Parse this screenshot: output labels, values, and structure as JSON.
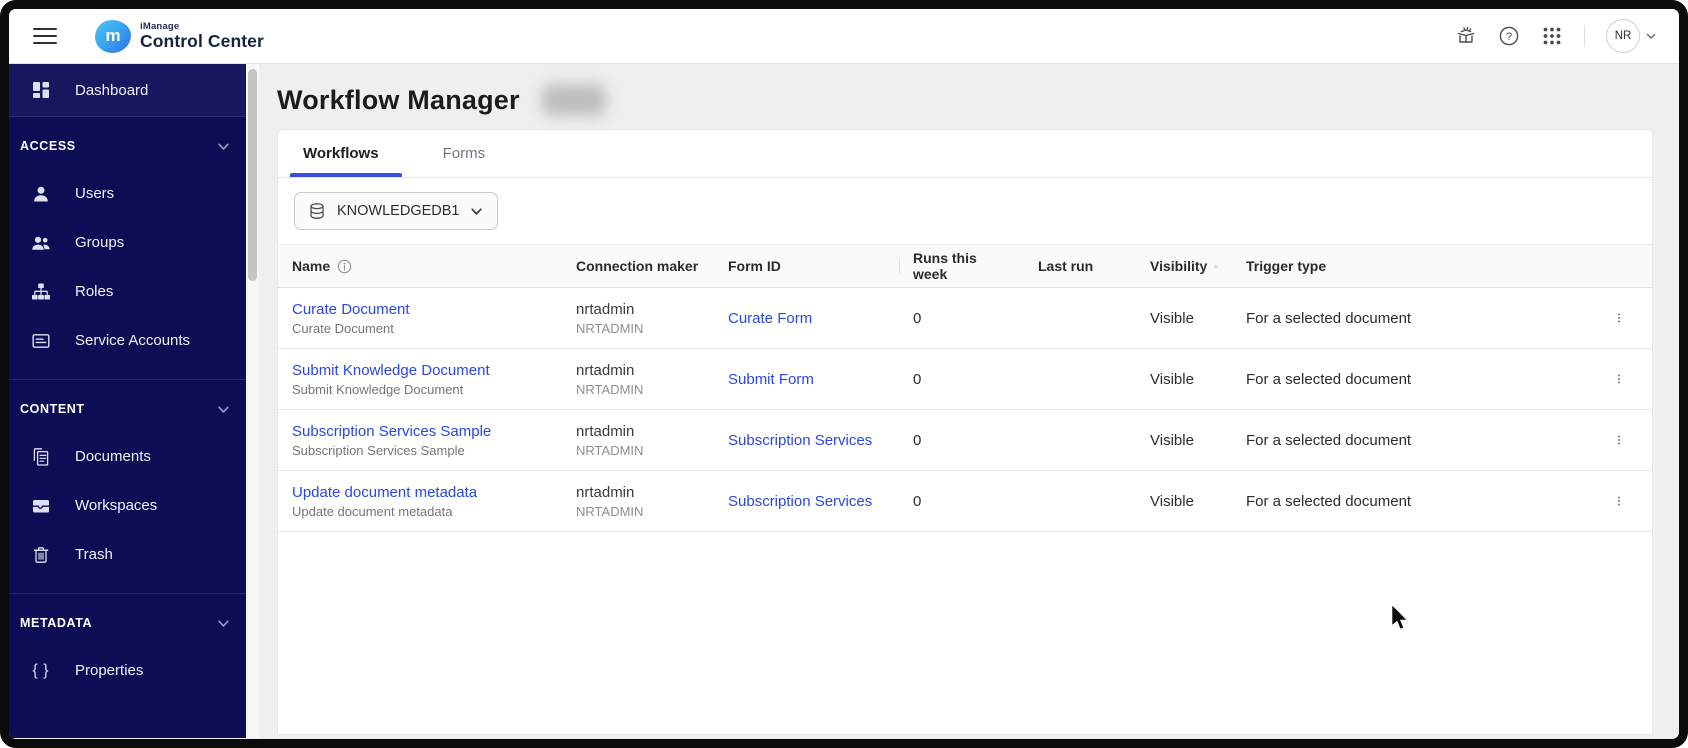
{
  "colors": {
    "sidebar_navy": "#0d0d55",
    "sidebar_active_navy": "#17175f",
    "accent_blue": "#3b4ce0",
    "link_blue": "#2b46e8",
    "content_bg": "#efefef"
  },
  "topbar": {
    "brand_small": "iManage",
    "brand_large": "Control Center",
    "avatar_initials": "NR",
    "icons": [
      "whats-new-icon",
      "help-icon",
      "apps-grid-icon"
    ]
  },
  "sidebar": {
    "dashboard_label": "Dashboard",
    "sections": [
      {
        "label": "ACCESS",
        "items": [
          {
            "icon": "user-icon",
            "label": "Users"
          },
          {
            "icon": "groups-icon",
            "label": "Groups"
          },
          {
            "icon": "roles-icon",
            "label": "Roles"
          },
          {
            "icon": "service-accounts-icon",
            "label": "Service Accounts"
          }
        ]
      },
      {
        "label": "CONTENT",
        "items": [
          {
            "icon": "documents-icon",
            "label": "Documents"
          },
          {
            "icon": "workspaces-icon",
            "label": "Workspaces"
          },
          {
            "icon": "trash-icon",
            "label": "Trash"
          }
        ]
      },
      {
        "label": "METADATA",
        "items": [
          {
            "icon": "braces-icon",
            "label": "Properties"
          }
        ]
      }
    ]
  },
  "main": {
    "title": "Workflow Manager",
    "tabs": [
      {
        "label": "Workflows",
        "active": true
      },
      {
        "label": "Forms",
        "active": false
      }
    ],
    "library_selector": {
      "value": "KNOWLEDGEDB1"
    },
    "table": {
      "columns": [
        "Name",
        "Connection maker",
        "Form ID",
        "Runs this week",
        "Last run",
        "Visibility",
        "Trigger type"
      ],
      "rows": [
        {
          "name": "Curate Document",
          "description": "Curate Document",
          "connection_maker": "nrtadmin",
          "connection_maker_sub": "NRTADMIN",
          "form_id": "Curate Form",
          "runs_this_week": "0",
          "last_run": "",
          "visibility": "Visible",
          "trigger_type": "For a selected document"
        },
        {
          "name": "Submit Knowledge Document",
          "description": "Submit Knowledge Document",
          "connection_maker": "nrtadmin",
          "connection_maker_sub": "NRTADMIN",
          "form_id": "Submit Form",
          "runs_this_week": "0",
          "last_run": "",
          "visibility": "Visible",
          "trigger_type": "For a selected document"
        },
        {
          "name": "Subscription Services Sample",
          "description": "Subscription Services Sample",
          "connection_maker": "nrtadmin",
          "connection_maker_sub": "NRTADMIN",
          "form_id": "Subscription Services",
          "runs_this_week": "0",
          "last_run": "",
          "visibility": "Visible",
          "trigger_type": "For a selected document"
        },
        {
          "name": "Update document metadata",
          "description": "Update document metadata",
          "connection_maker": "nrtadmin",
          "connection_maker_sub": "NRTADMIN",
          "form_id": "Subscription Services",
          "runs_this_week": "0",
          "last_run": "",
          "visibility": "Visible",
          "trigger_type": "For a selected document"
        }
      ]
    }
  }
}
